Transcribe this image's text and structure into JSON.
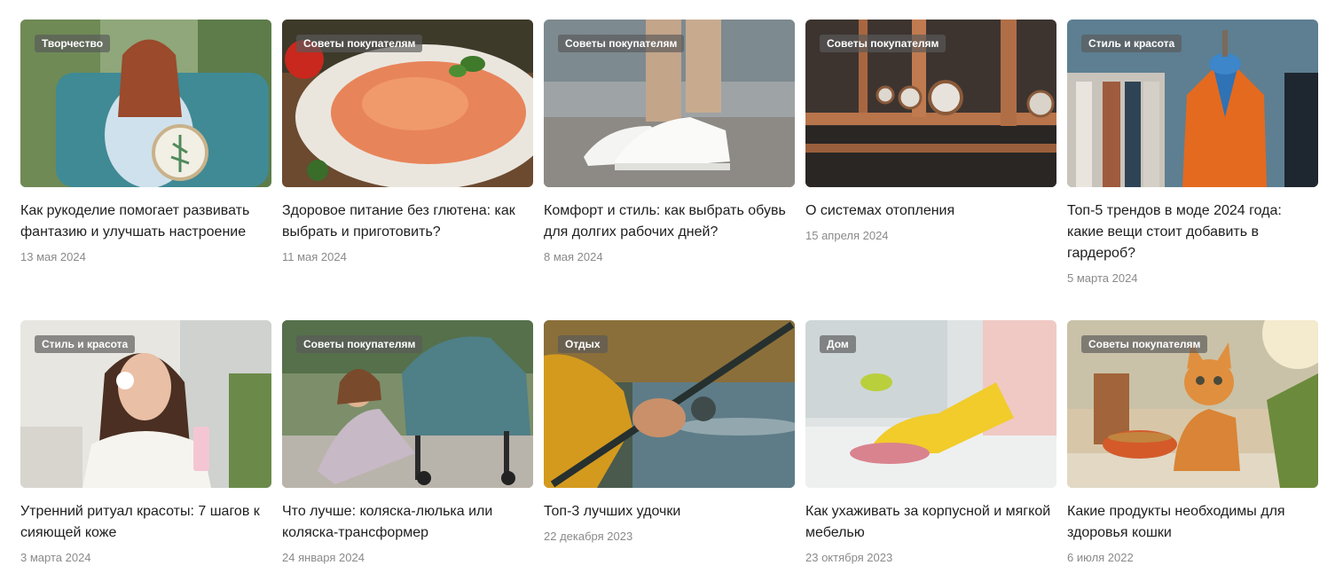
{
  "articles": [
    {
      "category": "Творчество",
      "title": "Как рукоделие помогает развивать фантазию и улучшать настроение",
      "date": "13 мая 2024",
      "image": "embroidery-photo"
    },
    {
      "category": "Советы покупателям",
      "title": "Здоровое питание без глютена: как выбрать и приготовить?",
      "date": "11 мая 2024",
      "image": "pasta-photo"
    },
    {
      "category": "Советы покупателям",
      "title": "Комфорт и стиль: как выбрать обувь для долгих рабочих дней?",
      "date": "8 мая 2024",
      "image": "sneakers-photo"
    },
    {
      "category": "Советы покупателям",
      "title": "О системах отопления",
      "date": "15 апреля 2024",
      "image": "heating-pipes-photo"
    },
    {
      "category": "Стиль и красота",
      "title": "Топ-5 трендов в моде 2024 года: какие вещи стоит добавить в гардероб?",
      "date": "5 марта 2024",
      "image": "orange-coat-photo"
    },
    {
      "category": "Стиль и красота",
      "title": "Утренний ритуал красоты: 7 шагов к сияющей коже",
      "date": "3 марта 2024",
      "image": "skincare-photo"
    },
    {
      "category": "Советы покупателям",
      "title": "Что лучше: коляска-люлька или коляска-трансформер",
      "date": "24 января 2024",
      "image": "stroller-photo"
    },
    {
      "category": "Отдых",
      "title": "Топ-3 лучших удочки",
      "date": "22 декабря 2023",
      "image": "fishing-rod-photo"
    },
    {
      "category": "Дом",
      "title": "Как ухаживать за корпусной и мягкой мебелью",
      "date": "23 октября 2023",
      "image": "cleaning-glove-photo"
    },
    {
      "category": "Советы покупателям",
      "title": "Какие продукты необходимы для здоровья кошки",
      "date": "6 июля 2022",
      "image": "kitten-photo"
    }
  ]
}
